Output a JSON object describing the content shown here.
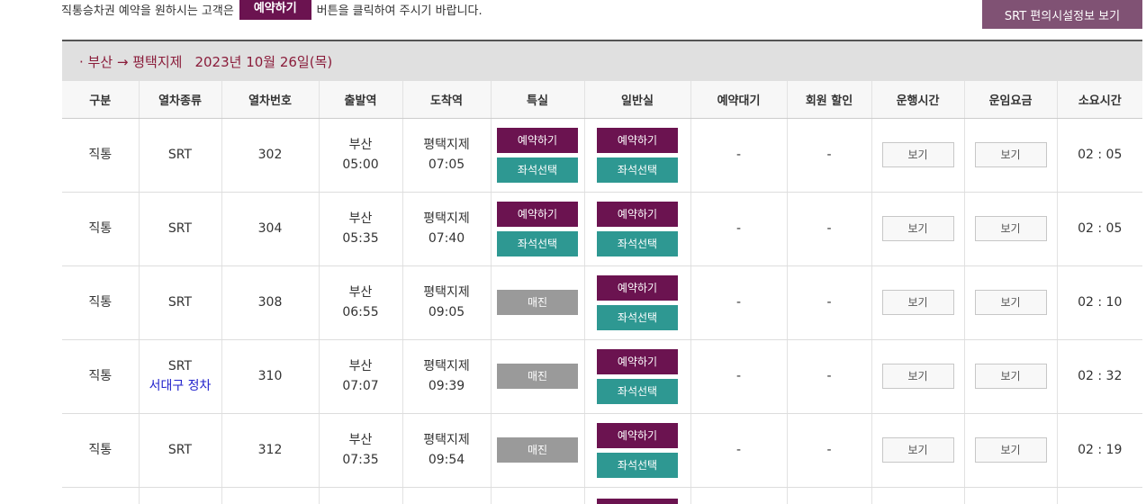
{
  "notice": {
    "before": "직통승차권 예약을 원하시는 고객은",
    "badge": "예약하기",
    "after": "버튼을 클릭하여 주시기 바랍니다."
  },
  "facility_button": "SRT 편의시설정보 보기",
  "route": {
    "label": "· 부산 → 평택지제",
    "date": "2023년 10월 26일(목)"
  },
  "columns": [
    "구분",
    "열차종류",
    "열차번호",
    "출발역",
    "도착역",
    "특실",
    "일반실",
    "예약대기",
    "회원 할인",
    "운행시간",
    "운임요금",
    "소요시간"
  ],
  "labels": {
    "reserve": "예약하기",
    "seat_select": "좌석선택",
    "sold_out": "매진",
    "view": "보기",
    "dash": "-"
  },
  "rows": [
    {
      "category": "직통",
      "train_type": "SRT",
      "train_note": "",
      "train_no": "302",
      "dep_station": "부산",
      "dep_time": "05:00",
      "arr_station": "평택지제",
      "arr_time": "07:05",
      "first_class": "available",
      "standard": "available",
      "waitlist": "-",
      "member_discount": "-",
      "duration": "02 : 05"
    },
    {
      "category": "직통",
      "train_type": "SRT",
      "train_note": "",
      "train_no": "304",
      "dep_station": "부산",
      "dep_time": "05:35",
      "arr_station": "평택지제",
      "arr_time": "07:40",
      "first_class": "available",
      "standard": "available",
      "waitlist": "-",
      "member_discount": "-",
      "duration": "02 : 05"
    },
    {
      "category": "직통",
      "train_type": "SRT",
      "train_note": "",
      "train_no": "308",
      "dep_station": "부산",
      "dep_time": "06:55",
      "arr_station": "평택지제",
      "arr_time": "09:05",
      "first_class": "sold_out",
      "standard": "available",
      "waitlist": "-",
      "member_discount": "-",
      "duration": "02 : 10"
    },
    {
      "category": "직통",
      "train_type": "SRT",
      "train_note": "서대구 정차",
      "train_no": "310",
      "dep_station": "부산",
      "dep_time": "07:07",
      "arr_station": "평택지제",
      "arr_time": "09:39",
      "first_class": "sold_out",
      "standard": "available",
      "waitlist": "-",
      "member_discount": "-",
      "duration": "02 : 32"
    },
    {
      "category": "직통",
      "train_type": "SRT",
      "train_note": "",
      "train_no": "312",
      "dep_station": "부산",
      "dep_time": "07:35",
      "arr_station": "평택지제",
      "arr_time": "09:54",
      "first_class": "sold_out",
      "standard": "available",
      "waitlist": "-",
      "member_discount": "-",
      "duration": "02 : 19"
    }
  ]
}
